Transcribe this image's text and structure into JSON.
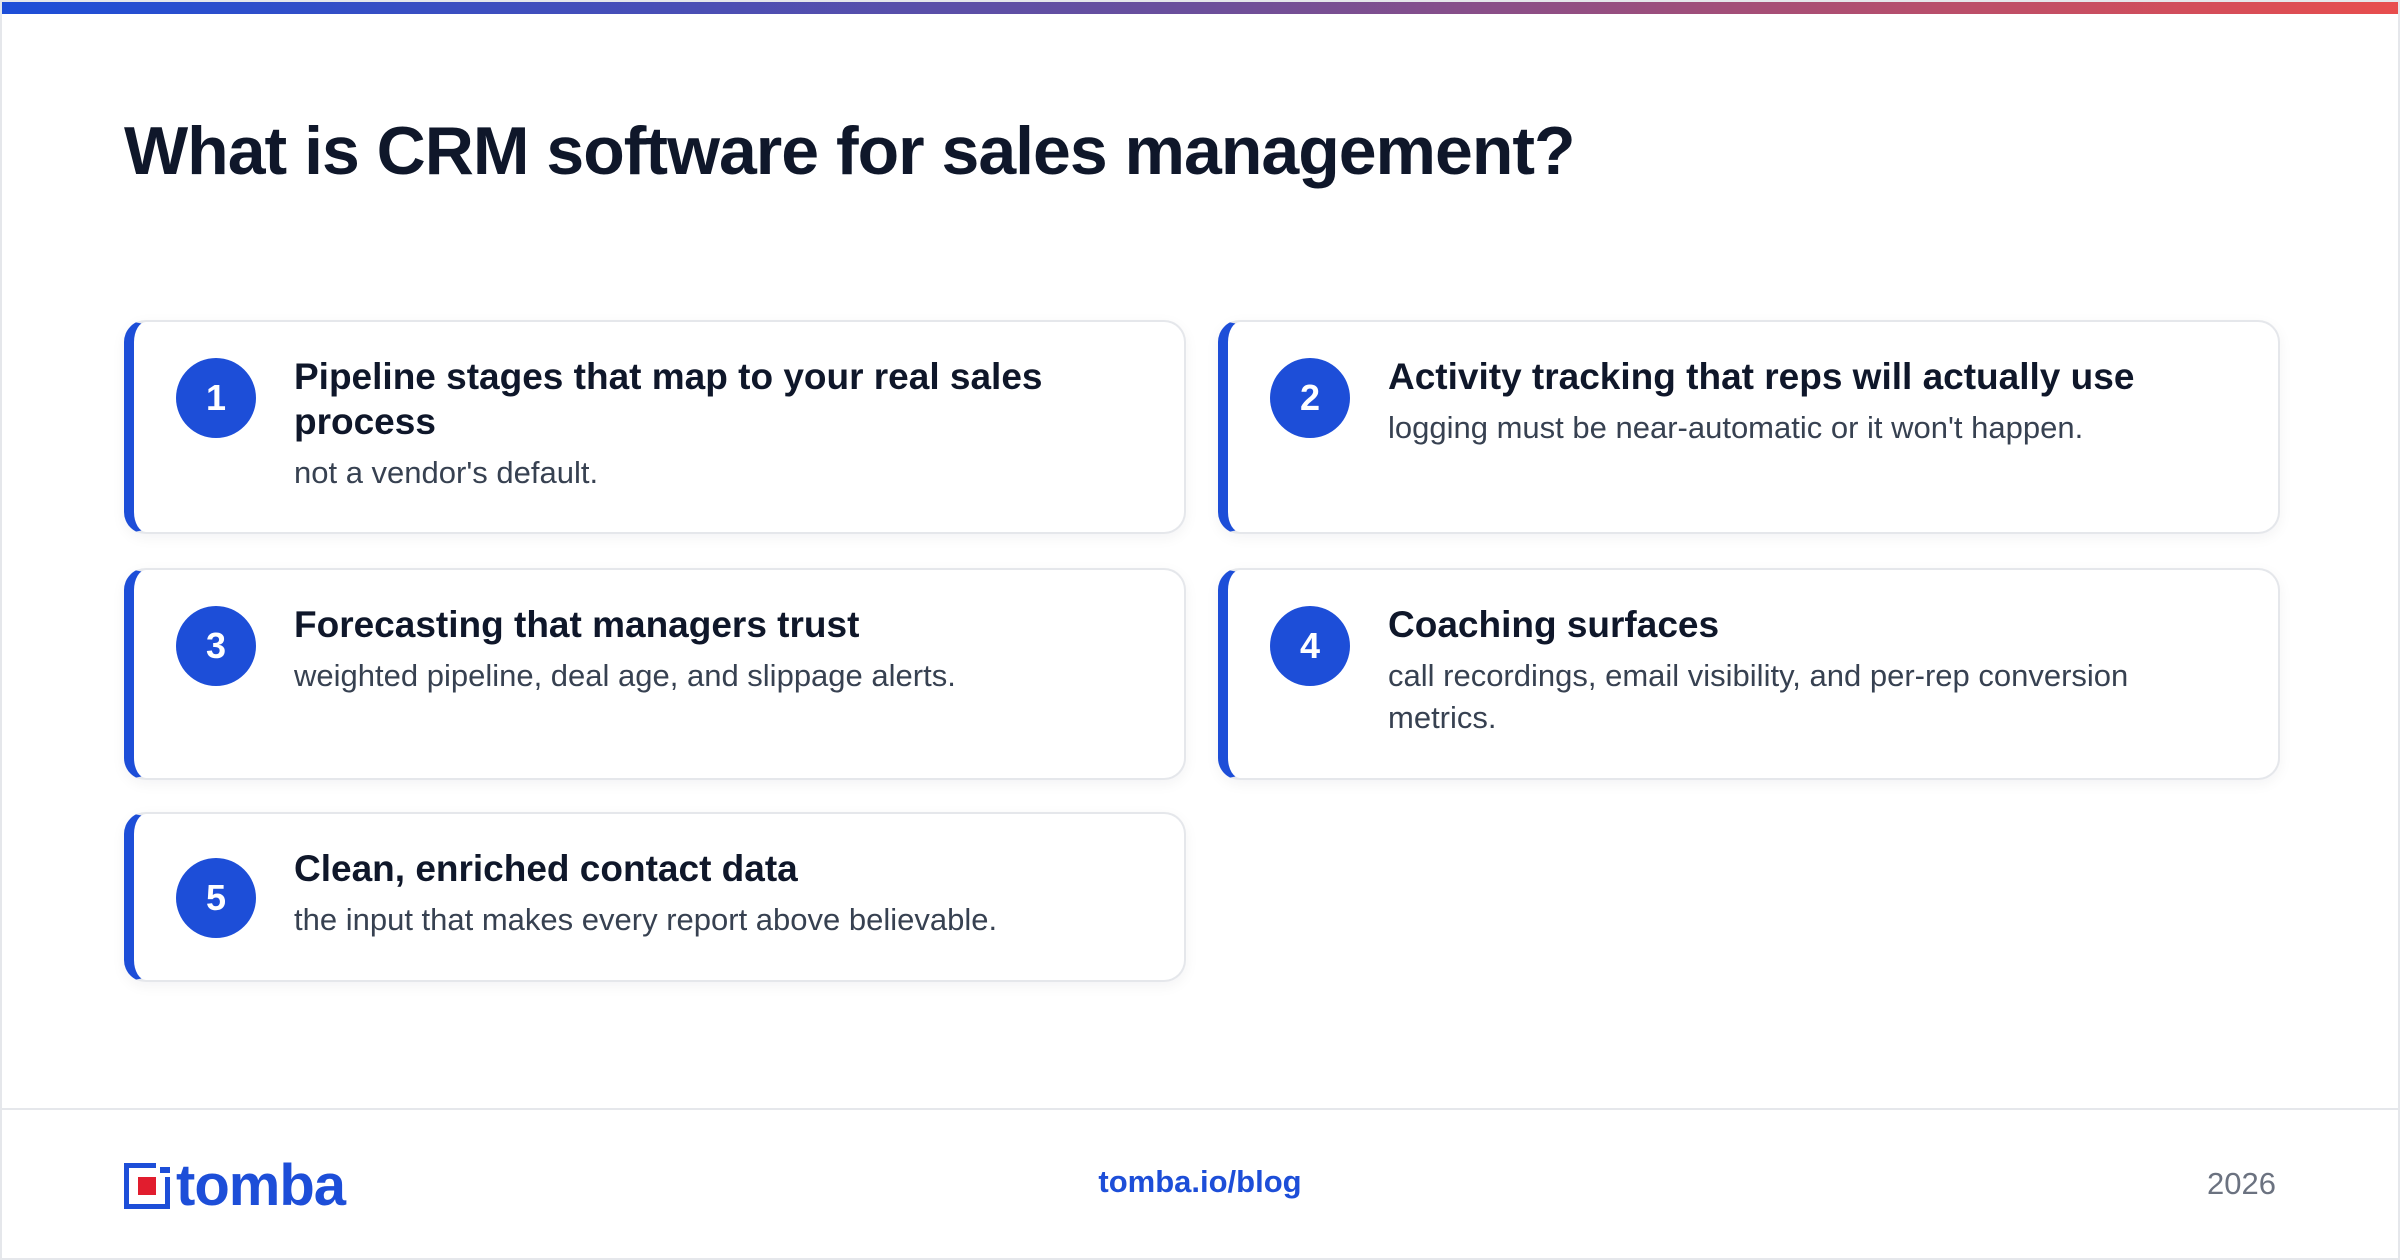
{
  "page": {
    "title": "What is CRM software for sales management?"
  },
  "cards": [
    {
      "number": "1",
      "title": "Pipeline stages that map to your real sales process",
      "description": "not a vendor's default."
    },
    {
      "number": "2",
      "title": "Activity tracking that reps will actually use",
      "description": "logging must be near-automatic or it won't happen."
    },
    {
      "number": "3",
      "title": "Forecasting that managers trust",
      "description": "weighted pipeline, deal age, and slippage alerts."
    },
    {
      "number": "4",
      "title": "Coaching surfaces",
      "description": "call recordings, email visibility, and per-rep conversion metrics."
    },
    {
      "number": "5",
      "title": "Clean, enriched contact data",
      "description": "the input that makes every report above believable."
    }
  ],
  "footer": {
    "logo_text": "tomba",
    "link": "tomba.io/blog",
    "year": "2026"
  },
  "colors": {
    "accent": "#1d4ed8",
    "gradient_start": "#1d4ed8",
    "gradient_end": "#e84d4d",
    "logo_red": "#e11d2e",
    "text_dark": "#0f172a",
    "text_muted": "#374151"
  },
  "icons": {
    "logo_mark": "tomba-logo-mark-icon"
  }
}
